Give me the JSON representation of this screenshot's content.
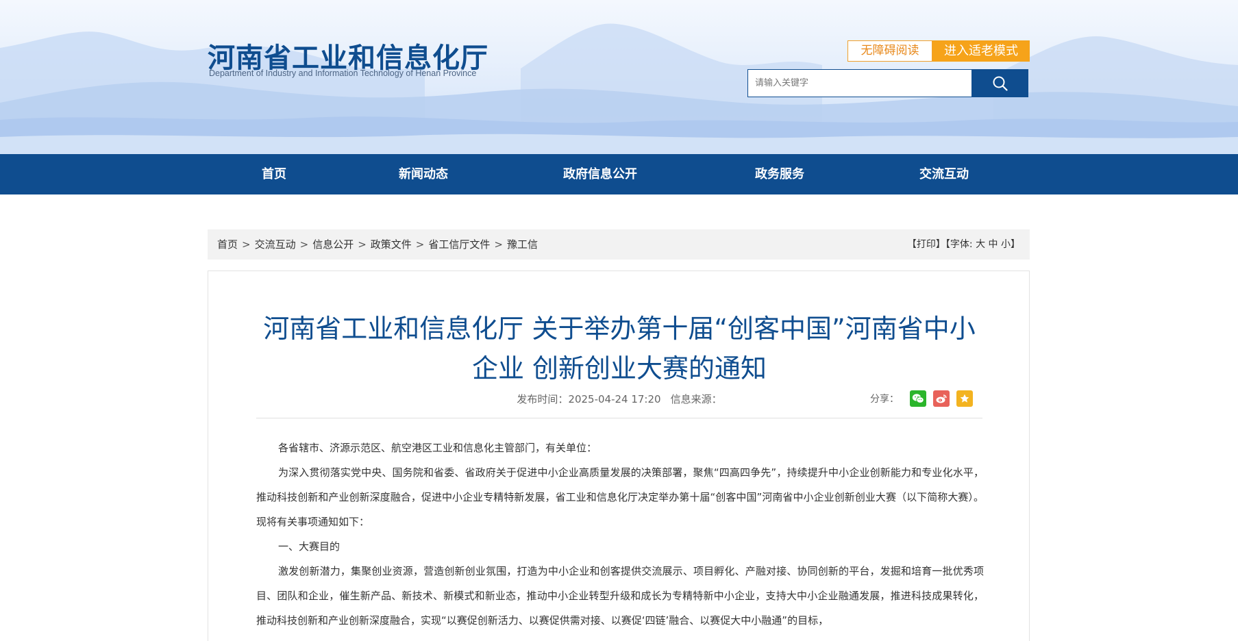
{
  "header": {
    "logo_cn": "河南省工业和信息化厅",
    "logo_en": "Department of Industry and Information Technology of Henan Province",
    "accessible_label": "无障碍阅读",
    "elder_mode_label": "进入适老模式",
    "search_placeholder": "请输入关键字"
  },
  "nav": {
    "items": [
      {
        "label": "首页"
      },
      {
        "label": "新闻动态"
      },
      {
        "label": "政府信息公开"
      },
      {
        "label": "政务服务"
      },
      {
        "label": "交流互动"
      }
    ]
  },
  "breadcrumb": {
    "items": [
      "首页",
      "交流互动",
      "信息公开",
      "政策文件",
      "省工信厅文件",
      "豫工信"
    ],
    "separator": ">"
  },
  "tools": {
    "print": "【打印】",
    "font_label": "【字体:",
    "font_large": "大",
    "font_medium": "中",
    "font_small": "小",
    "font_close": "】"
  },
  "article": {
    "title": "河南省工业和信息化厅 关于举办第十届“创客中国”河南省中小企业 创新创业大赛的通知",
    "publish_label": "发布时间：",
    "publish_time": "2025-04-24 17:20",
    "source_label": "信息来源：",
    "share_label": "分享：",
    "share_icons": [
      "wechat-icon",
      "weibo-icon",
      "star-icon"
    ],
    "paragraphs": [
      "各省辖市、济源示范区、航空港区工业和信息化主管部门，有关单位：",
      "为深入贯彻落实党中央、国务院和省委、省政府关于促进中小企业高质量发展的决策部署，聚焦“四高四争先”，持续提升中小企业创新能力和专业化水平，推动科技创新和产业创新深度融合，促进中小企业专精特新发展，省工业和信息化厅决定举办第十届“创客中国”河南省中小企业创新创业大赛（以下简称大赛）。现将有关事项通知如下：",
      "一、大赛目的",
      "激发创新潜力，集聚创业资源，营造创新创业氛围，打造为中小企业和创客提供交流展示、项目孵化、产融对接、协同创新的平台，发掘和培育一批优秀项目、团队和企业，催生新产品、新技术、新模式和新业态，推动中小企业转型升级和成长为专精特新中小企业，支持大中小企业融通发展，推进科技成果转化，推动科技创新和产业创新深度融合，实现“以赛促创新活力、以赛促供需对接、以赛促‘四链’融合、以赛促大中小融通”的目标，"
    ]
  },
  "colors": {
    "brand_blue": "#0f4d8f",
    "accent_orange": "#f6a31a",
    "wechat_green": "#2bb52b",
    "weibo_red": "#e8625a",
    "star_yellow": "#f3b320"
  }
}
